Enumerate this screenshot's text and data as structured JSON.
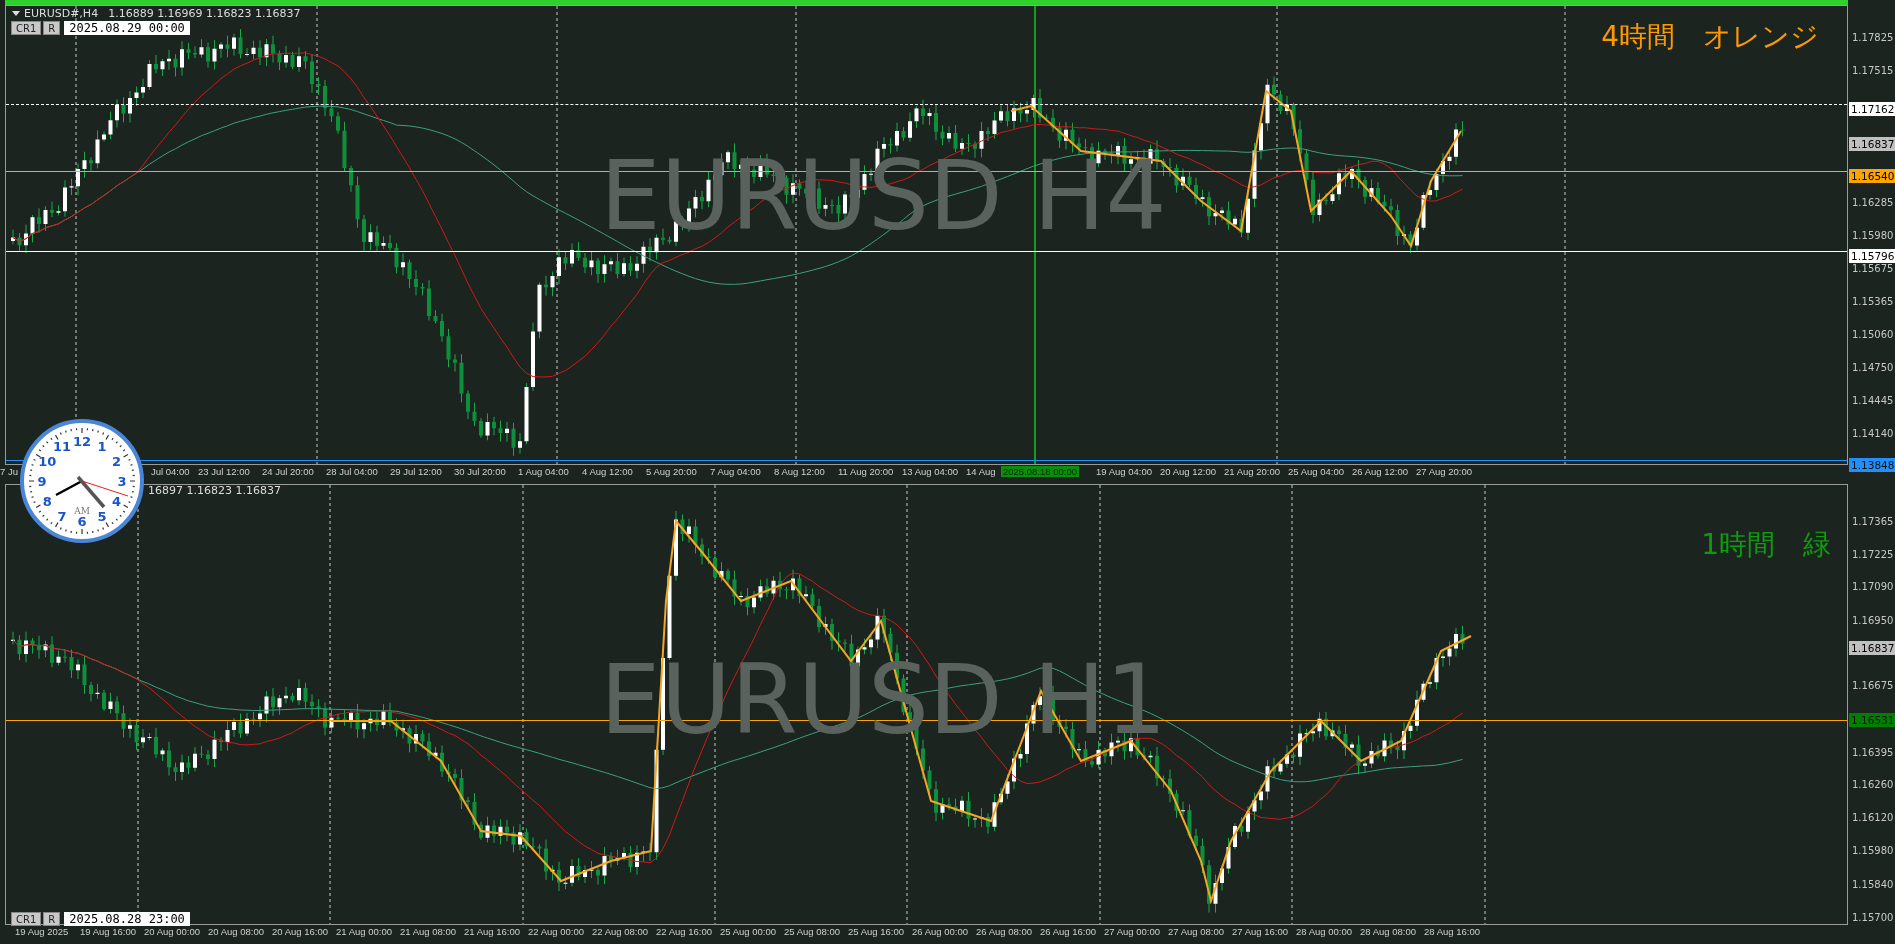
{
  "charts": [
    {
      "header": {
        "symbol": "EURUSD#,H4",
        "quote": "1.16889 1.16969 1.16823 1.16837"
      },
      "buttons": [
        "CR1",
        "R"
      ],
      "date_field": "2025.08.29 00:00",
      "watermark": "EURUSD H4",
      "note": {
        "text": "4時間　オレンジ",
        "color": "#ff9900"
      },
      "price_labels": [
        "1.17825",
        "1.17515",
        "1.16285",
        "1.15980",
        "1.15675",
        "1.15365",
        "1.15060",
        "1.14750",
        "1.14445",
        "1.14140"
      ],
      "price_tags": [
        {
          "text": "1.17162",
          "color": "#ffffff",
          "line": {
            "color": "#ffffff",
            "dashed": true
          }
        },
        {
          "text": "1.16837",
          "color": "#c0c0c0"
        },
        {
          "text": "1.16540",
          "color": "#ffa500",
          "line": {
            "color": "#ffa500",
            "dashed": false
          }
        },
        {
          "text": "1.15796",
          "color": "#ffffff",
          "line": {
            "color": "#ffffff",
            "dashed": false
          }
        },
        {
          "text": "1.13848",
          "color": "#1e90ff",
          "line": {
            "color": "#1e90ff",
            "dashed": false
          }
        }
      ],
      "time_labels": [
        "7 Ju",
        "Jul 04:00",
        "23 Jul 12:00",
        "24 Jul 20:00",
        "28 Jul 04:00",
        "29 Jul 12:00",
        "30 Jul 20:00",
        "1 Aug 04:00",
        "4 Aug 12:00",
        "5 Aug 20:00",
        "7 Aug 04:00",
        "8 Aug 12:00",
        "11 Aug 20:00",
        "13 Aug 04:00",
        "14 Aug",
        "19 Aug 04:00",
        "20 Aug 12:00",
        "21 Aug 20:00",
        "25 Aug 04:00",
        "26 Aug 12:00",
        "27 Aug 20:00"
      ],
      "cursor_time": "2025.08.18 00:00"
    },
    {
      "header": {
        "quote": "16897 1.16823 1.16837"
      },
      "buttons": [
        "CR1",
        "R"
      ],
      "date_field": "2025.08.28 23:00",
      "watermark": "EURUSD H1",
      "note": {
        "text": "1時間　緑",
        "color": "#119911"
      },
      "price_labels": [
        "1.17365",
        "1.17225",
        "1.17090",
        "1.16950",
        "1.16675",
        "1.16395",
        "1.16260",
        "1.16120",
        "1.15980",
        "1.15840",
        "1.15700"
      ],
      "price_tags": [
        {
          "text": "1.16837",
          "color": "#c0c0c0"
        },
        {
          "text": "1.16531",
          "color": "#008000",
          "line": {
            "color": "#ffa500",
            "dashed": false
          }
        }
      ],
      "time_labels": [
        "19 Aug 2025",
        "19 Aug 16:00",
        "20 Aug 00:00",
        "20 Aug 08:00",
        "20 Aug 16:00",
        "21 Aug 00:00",
        "21 Aug 08:00",
        "21 Aug 16:00",
        "22 Aug 00:00",
        "22 Aug 08:00",
        "22 Aug 16:00",
        "25 Aug 00:00",
        "25 Aug 08:00",
        "25 Aug 16:00",
        "26 Aug 00:00",
        "26 Aug 08:00",
        "26 Aug 16:00",
        "27 Aug 00:00",
        "27 Aug 08:00",
        "27 Aug 16:00",
        "28 Aug 00:00",
        "28 Aug 08:00",
        "28 Aug 16:00"
      ]
    }
  ],
  "clock": {
    "numbers": [
      "12",
      "11",
      "1",
      "10",
      "2",
      "9",
      "3",
      "8",
      "4",
      "7",
      "5",
      "6"
    ],
    "period": "AM"
  }
}
